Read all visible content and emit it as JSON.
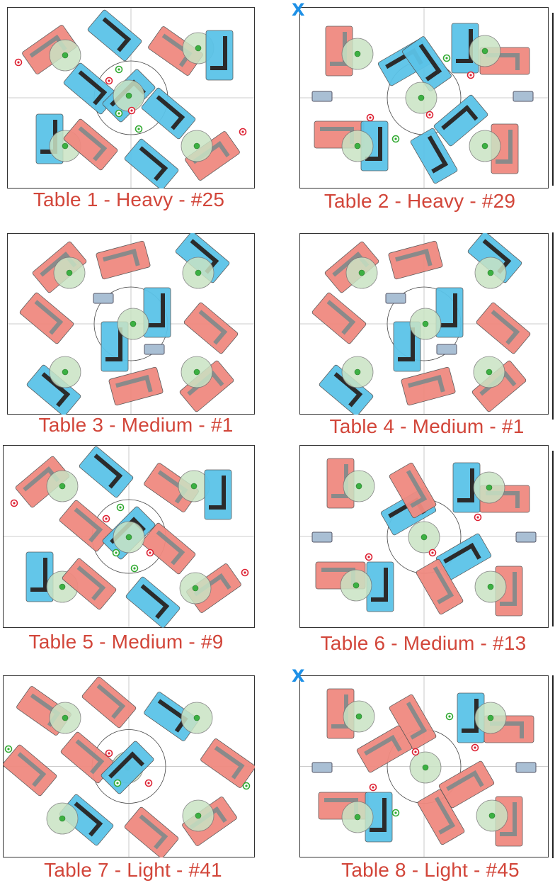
{
  "figure": {
    "panels": [
      {
        "id": "t1",
        "caption": "Table 1 - Heavy - #25",
        "marked": false,
        "center_screens": false,
        "dashed_grid": false
      },
      {
        "id": "t2",
        "caption": "Table 2 - Heavy - #29",
        "marked": true,
        "center_screens": true,
        "dashed_grid": false
      },
      {
        "id": "t3",
        "caption": "Table 3 - Medium - #1",
        "marked": false,
        "center_screens": true,
        "dashed_grid": false
      },
      {
        "id": "t4",
        "caption": "Table 4 - Medium - #1",
        "marked": false,
        "center_screens": true,
        "dashed_grid": false
      },
      {
        "id": "t5",
        "caption": "Table 5 - Medium - #9",
        "marked": false,
        "center_screens": false,
        "dashed_grid": false
      },
      {
        "id": "t6",
        "caption": "Table 6 - Medium - #13",
        "marked": false,
        "center_screens": true,
        "dashed_grid": false
      },
      {
        "id": "t7",
        "caption": "Table 7 - Light - #41",
        "marked": false,
        "center_screens": false,
        "dashed_grid": false
      },
      {
        "id": "t8",
        "caption": "Table 8 - Light - #45",
        "marked": true,
        "center_screens": true,
        "dashed_grid": false
      }
    ],
    "mark_symbol": "X",
    "colors": {
      "red_desk": "#f08a80",
      "blue_desk": "#5bc3e8",
      "chair_dark": "#2b2b2b",
      "chair_grey": "#8a8a8a",
      "person_fill": "#c9e3c4",
      "person_dot": "#3cb043",
      "caption": "#d2463a",
      "mark": "#1e90e6",
      "screen": "#a9bfd4"
    }
  }
}
